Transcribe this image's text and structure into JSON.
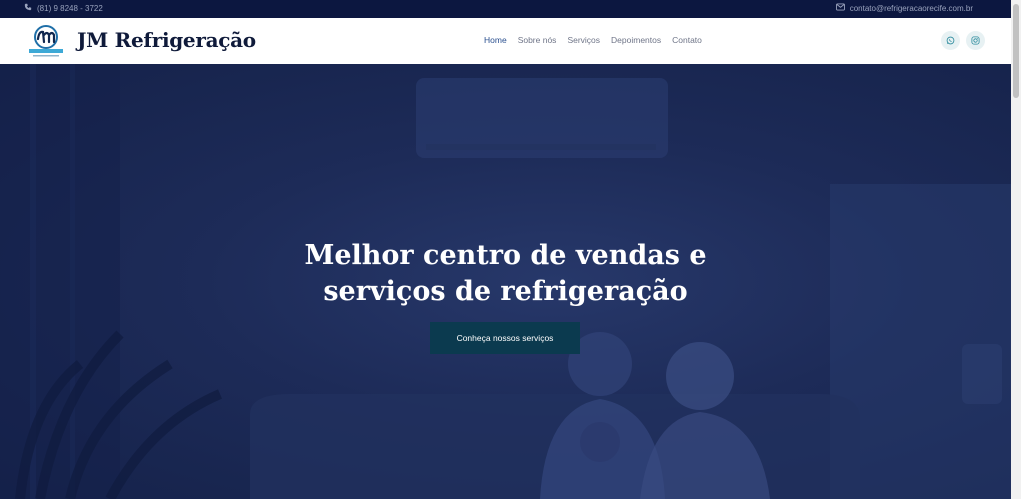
{
  "topbar": {
    "phone": "(81) 9 8248 - 3722",
    "email": "contato@refrigeracaorecife.com.br",
    "phone_icon": "phone-icon",
    "email_icon": "mail-icon"
  },
  "header": {
    "brand": "JM Refrigeração",
    "logo_icon": "jm-refrigeracao-logo",
    "menu": [
      {
        "label": "Home",
        "active": true
      },
      {
        "label": "Sobre nós"
      },
      {
        "label": "Serviços"
      },
      {
        "label": "Depoimentos"
      },
      {
        "label": "Contato"
      }
    ],
    "social": [
      "whatsapp-icon",
      "instagram-icon"
    ]
  },
  "hero": {
    "title_line1": "Melhor centro de vendas e",
    "title_line2": "serviços de refrigeração",
    "cta": "Conheça nossos serviços"
  },
  "colors": {
    "topbar_bg": "#0c1740",
    "hero_overlay": "#1d2b58",
    "cta_bg": "#0b3a4f",
    "active_link": "#2a4f8f",
    "social_bg": "#e7f1f3"
  }
}
